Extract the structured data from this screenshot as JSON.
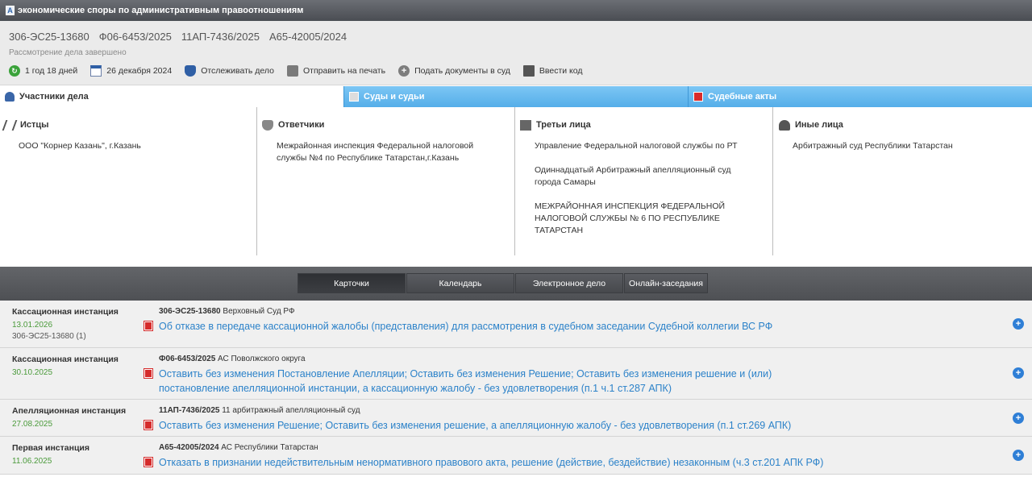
{
  "window": {
    "title": "экономические споры по административным правоотношениям"
  },
  "header": {
    "case_numbers": [
      "306-ЭС25-13680",
      "Ф06-6453/2025",
      "11АП-7436/2025",
      "А65-42005/2024"
    ],
    "status": "Рассмотрение дела завершено",
    "actions": [
      {
        "label": "1 год 18 дней",
        "icon": "clock-icon"
      },
      {
        "label": "26 декабря 2024",
        "icon": "calendar-icon"
      },
      {
        "label": "Отслеживать дело",
        "icon": "shield-icon"
      },
      {
        "label": "Отправить на печать",
        "icon": "printer-icon"
      },
      {
        "label": "Подать документы в суд",
        "icon": "plus-icon"
      },
      {
        "label": "Ввести код",
        "icon": "key-icon"
      }
    ]
  },
  "tabs": [
    {
      "label": "Участники дела",
      "active": true
    },
    {
      "label": "Суды и судьи",
      "active": false
    },
    {
      "label": "Судебные акты",
      "active": false
    }
  ],
  "participants": {
    "plaintiffs": {
      "heading": "Истцы",
      "items": [
        "ООО \"Корнер Казань\", г.Казань"
      ]
    },
    "defendants": {
      "heading": "Ответчики",
      "items": [
        "Межрайонная инспекция Федеральной налоговой службы №4 по Республике Татарстан,г.Казань"
      ]
    },
    "third_parties": {
      "heading": "Третьи лица",
      "items": [
        "Управление Федеральной налоговой службы по РТ",
        "Одиннадцатый Арбитражный апелляционный суд города Самары",
        "МЕЖРАЙОННАЯ ИНСПЕКЦИЯ ФЕДЕРАЛЬНОЙ НАЛОГОВОЙ СЛУЖБЫ № 6 ПО РЕСПУБЛИКЕ ТАТАРСТАН"
      ]
    },
    "others": {
      "heading": "Иные лица",
      "items": [
        "Арбитражный суд Республики Татарстан"
      ]
    }
  },
  "cards_tabs": [
    "Карточки",
    "Календарь",
    "Электронное дело",
    "Онлайн-заседания"
  ],
  "instances": [
    {
      "instance": "Кассационная инстанция",
      "date": "13.01.2026",
      "sub_number": "306-ЭС25-13680 (1)",
      "case_number": "306-ЭС25-13680",
      "court": "Верховный Суд РФ",
      "decision": "Об отказе в передаче кассационной жалобы (представления) для рассмотрения в судебном заседании Судебной коллегии ВС РФ"
    },
    {
      "instance": "Кассационная инстанция",
      "date": "30.10.2025",
      "sub_number": "",
      "case_number": "Ф06-6453/2025",
      "court": "АС Поволжского округа",
      "decision": "Оставить без изменения Постановление Апелляции; Оставить без изменения Решение; Оставить без изменения решение и (или) постановление апелляционной инстанции, а кассационную жалобу - без удовлетворения (п.1 ч.1 ст.287 АПК)"
    },
    {
      "instance": "Апелляционная инстанция",
      "date": "27.08.2025",
      "sub_number": "",
      "case_number": "11АП-7436/2025",
      "court": "11 арбитражный апелляционный суд",
      "decision": "Оставить без изменения Решение; Оставить без изменения решение, а апелляционную жалобу - без удовлетворения (п.1 ст.269 АПК)"
    },
    {
      "instance": "Первая инстанция",
      "date": "11.06.2025",
      "sub_number": "",
      "case_number": "А65-42005/2024",
      "court": "АС Республики Татарстан",
      "decision": "Отказать в признании недействительным ненормативного правового акта, решение (действие, бездействие) незаконным (ч.3 ст.201 АПК РФ)"
    }
  ],
  "colors": {
    "link": "#2c82c9",
    "date": "#4a9a3a",
    "tab_blue": "#55aee9",
    "expand": "#2f7fd6"
  }
}
